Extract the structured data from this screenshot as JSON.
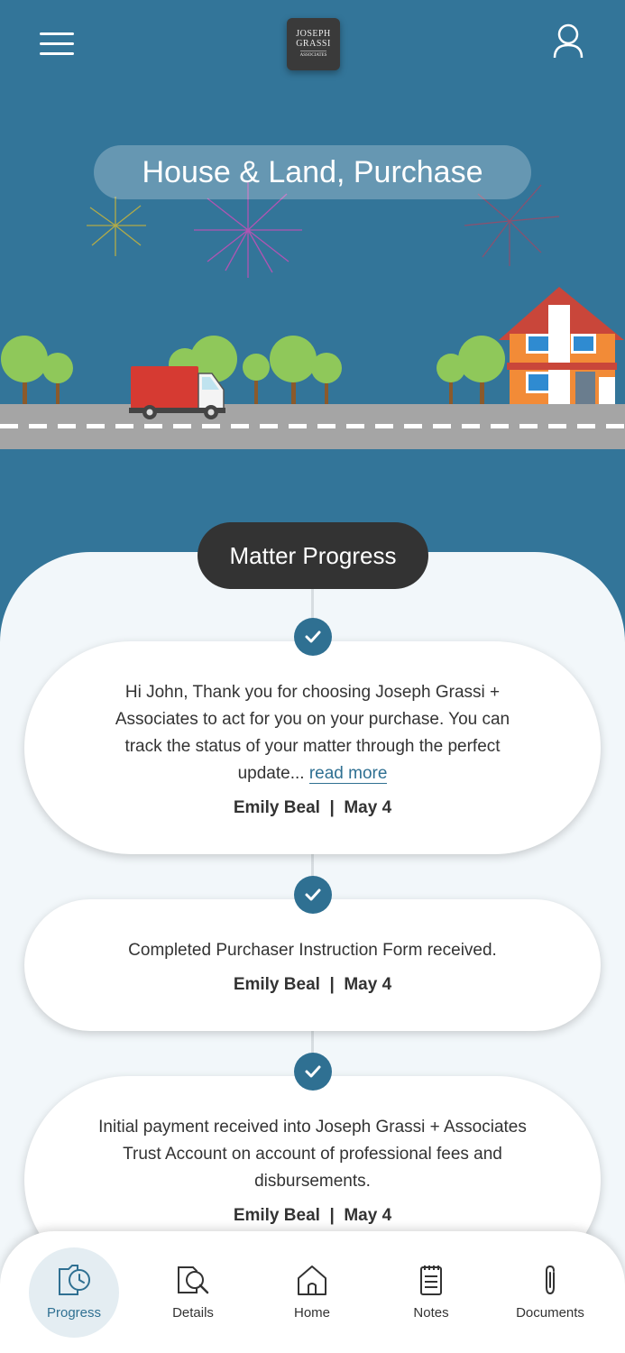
{
  "header": {
    "logo_line1": "JOSEPH",
    "logo_line2": "GRASSI",
    "logo_line3": "ASSOCIATES",
    "title": "House & Land, Purchase"
  },
  "progress": {
    "heading": "Matter Progress",
    "items": [
      {
        "message": "Hi John, Thank you for choosing Joseph Grassi + Associates to act for you on your purchase.  You can track the status of your matter through the perfect update...",
        "read_more": "read more",
        "author": "Emily Beal",
        "date": "May 4"
      },
      {
        "message": "Completed Purchaser Instruction Form received.",
        "author": "Emily Beal",
        "date": "May 4"
      },
      {
        "message": "Initial payment received into Joseph Grassi + Associates Trust Account on account of professional fees and disbursements.",
        "author": "Emily Beal",
        "date": "May 4"
      }
    ]
  },
  "nav": {
    "items": [
      {
        "label": "Progress",
        "icon": "progress-icon",
        "active": true
      },
      {
        "label": "Details",
        "icon": "details-icon"
      },
      {
        "label": "Home",
        "icon": "home-icon"
      },
      {
        "label": "Notes",
        "icon": "notes-icon"
      },
      {
        "label": "Documents",
        "icon": "documents-icon"
      }
    ]
  },
  "colors": {
    "hero_bg": "#337599",
    "accent": "#2f7092",
    "dark_pill": "#333333",
    "card_area": "#f2f7fa"
  }
}
